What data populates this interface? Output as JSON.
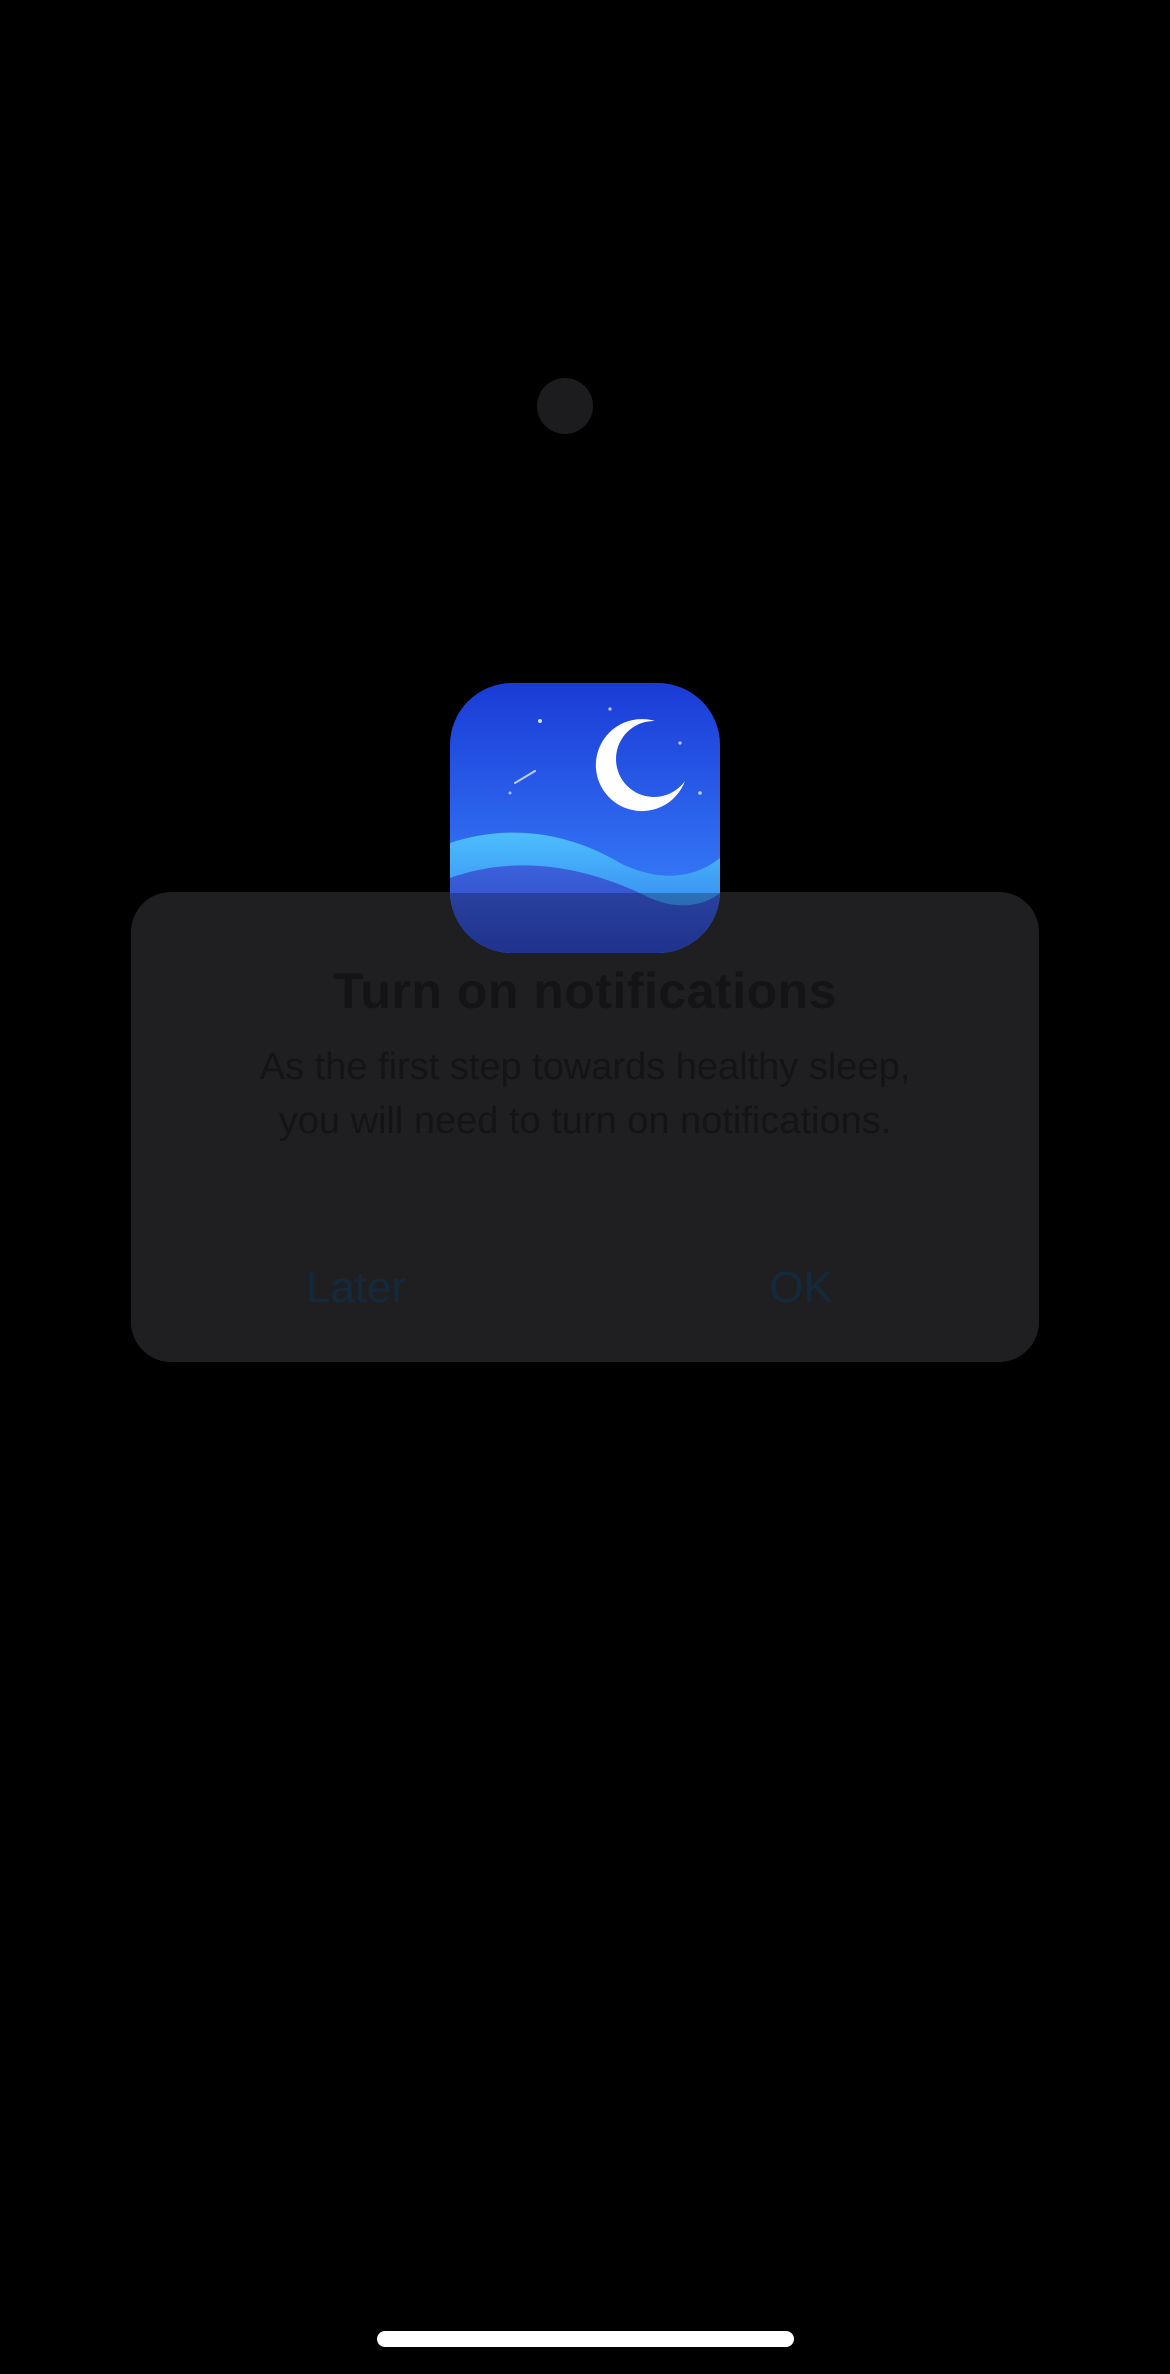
{
  "dialog": {
    "title": "Turn on notifications",
    "message_line1": "As the first step towards healthy sleep,",
    "message_line2": "you will need to turn on notifications.",
    "later_label": "Later",
    "ok_label": "OK"
  },
  "icons": {
    "app": "moon-night-app-icon",
    "camera": "camera-dot"
  },
  "colors": {
    "background": "#000000",
    "dialog_bg": "#1f1f21",
    "icon_gradient_top": "#1f44d8",
    "icon_gradient_bottom": "#3a8cff",
    "button_text": "#132a3d"
  }
}
